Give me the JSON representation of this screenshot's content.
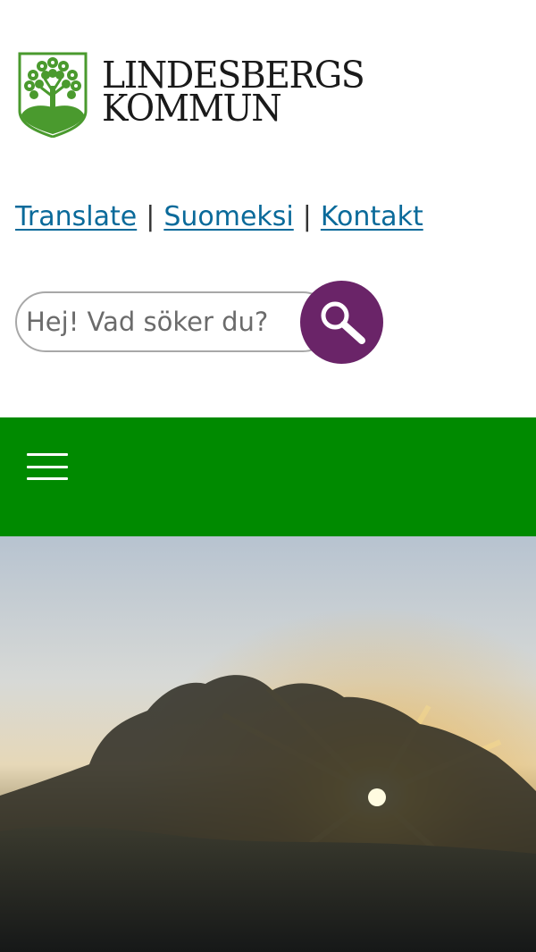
{
  "brand": {
    "name_line1": "LINDESBERGS",
    "name_line2": "KOMMUN",
    "emblem_icon": "tree-emblem-icon",
    "emblem_color": "#4a9a2e"
  },
  "toplinks": {
    "translate": "Translate",
    "separator": "|",
    "finnish": "Suomeksi",
    "contact": "Kontakt "
  },
  "search": {
    "placeholder": "Hej! Vad söker du?",
    "value": "",
    "button_icon": "magnifier-icon",
    "button_color": "#6a2468"
  },
  "navigation": {
    "menu_icon": "hamburger-menu-icon",
    "bar_color": "#008a00"
  },
  "hero": {
    "image": "sunrise-forest-image"
  },
  "colors": {
    "link": "#0a6a9a"
  }
}
